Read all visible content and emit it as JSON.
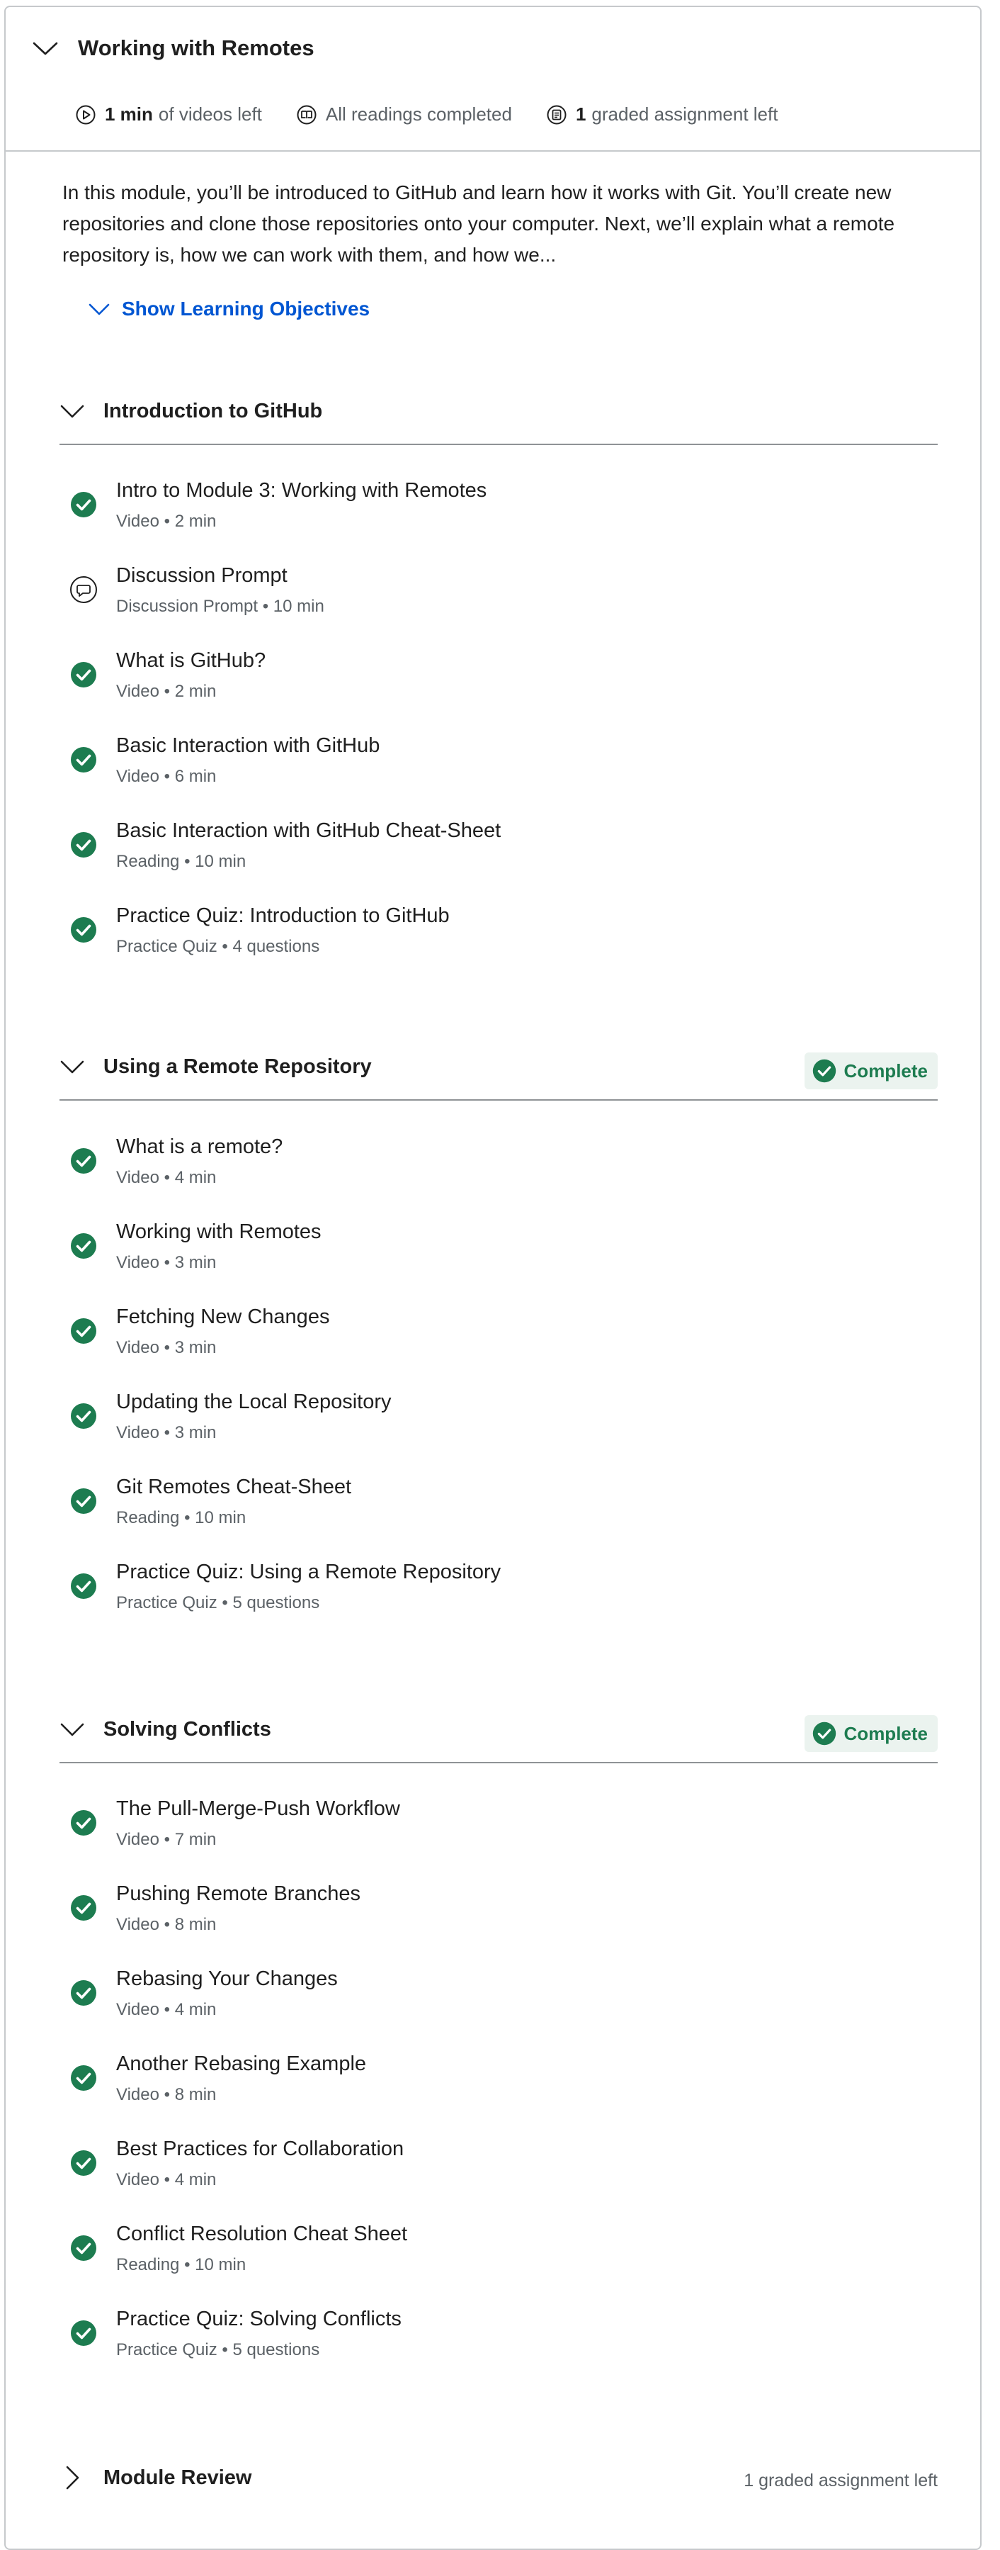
{
  "module": {
    "title": "Working with Remotes",
    "stats": {
      "videos_value": "1 min",
      "videos_text": "of videos left",
      "readings_text": "All readings completed",
      "graded_value": "1",
      "graded_text": "graded assignment left"
    },
    "description": "In this module, you’ll be introduced to GitHub and learn how it works with Git. You’ll create new repositories and clone those repositories onto your computer. Next, we’ll explain what a remote repository is, how we can work with them, and how we...",
    "show_objectives": "Show Learning Objectives"
  },
  "sections": [
    {
      "title": "Introduction to GitHub",
      "badge": "",
      "items": [
        {
          "title": "Intro to Module 3: Working with Remotes",
          "meta": "Video • 2 min",
          "status": "complete"
        },
        {
          "title": "Discussion Prompt",
          "meta": "Discussion Prompt • 10 min",
          "status": "discussion"
        },
        {
          "title": "What is GitHub?",
          "meta": "Video • 2 min",
          "status": "complete"
        },
        {
          "title": "Basic Interaction with GitHub",
          "meta": "Video • 6 min",
          "status": "complete"
        },
        {
          "title": "Basic Interaction with GitHub Cheat-Sheet",
          "meta": "Reading • 10 min",
          "status": "complete"
        },
        {
          "title": "Practice Quiz: Introduction to GitHub",
          "meta": "Practice Quiz • 4 questions",
          "status": "complete"
        }
      ]
    },
    {
      "title": "Using a Remote Repository",
      "badge": "Complete",
      "items": [
        {
          "title": "What is a remote?",
          "meta": "Video • 4 min",
          "status": "complete"
        },
        {
          "title": "Working with Remotes",
          "meta": "Video • 3 min",
          "status": "complete"
        },
        {
          "title": "Fetching New Changes",
          "meta": "Video • 3 min",
          "status": "complete"
        },
        {
          "title": "Updating the Local Repository",
          "meta": "Video • 3 min",
          "status": "complete"
        },
        {
          "title": "Git Remotes Cheat-Sheet",
          "meta": "Reading • 10 min",
          "status": "complete"
        },
        {
          "title": "Practice Quiz: Using a Remote Repository",
          "meta": "Practice Quiz • 5 questions",
          "status": "complete"
        }
      ]
    },
    {
      "title": "Solving Conflicts",
      "badge": "Complete",
      "items": [
        {
          "title": "The Pull-Merge-Push Workflow",
          "meta": "Video • 7 min",
          "status": "complete"
        },
        {
          "title": "Pushing Remote Branches",
          "meta": "Video • 8 min",
          "status": "complete"
        },
        {
          "title": "Rebasing Your Changes",
          "meta": "Video • 4 min",
          "status": "complete"
        },
        {
          "title": "Another Rebasing Example",
          "meta": "Video • 8 min",
          "status": "complete"
        },
        {
          "title": "Best Practices for Collaboration",
          "meta": "Video • 4 min",
          "status": "complete"
        },
        {
          "title": "Conflict Resolution Cheat Sheet",
          "meta": "Reading • 10 min",
          "status": "complete"
        },
        {
          "title": "Practice Quiz: Solving Conflicts",
          "meta": "Practice Quiz • 5 questions",
          "status": "complete"
        }
      ]
    }
  ],
  "review": {
    "title": "Module Review",
    "right_text": "1 graded assignment left"
  },
  "colors": {
    "accent": "#0056d2",
    "success": "#1d7c50",
    "badge_bg": "#ebf3ef"
  }
}
